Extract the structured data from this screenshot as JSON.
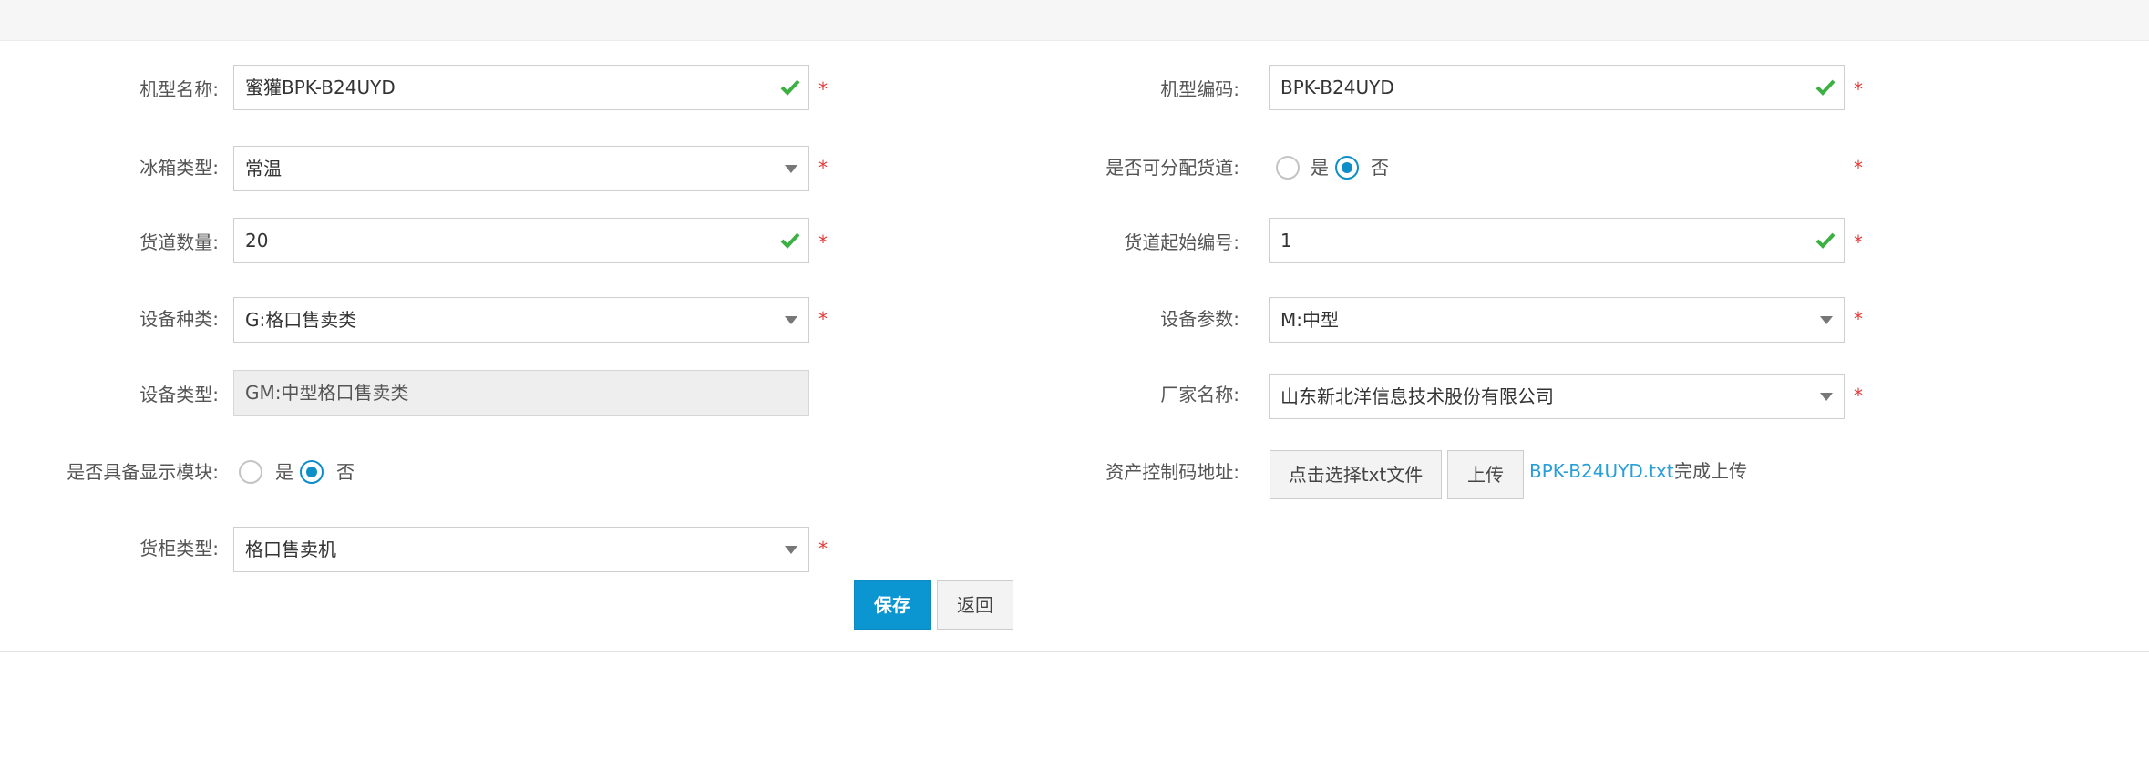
{
  "form": {
    "model_name": {
      "label": "机型名称:",
      "value": "蜜獾BPK-B24UYD"
    },
    "model_code": {
      "label": "机型编码:",
      "value": "BPK-B24UYD"
    },
    "fridge_type": {
      "label": "冰箱类型:",
      "value": "常温"
    },
    "allocatable_lanes": {
      "label": "是否可分配货道:",
      "option_yes": "是",
      "option_no": "否",
      "selected": "否"
    },
    "lane_count": {
      "label": "货道数量:",
      "value": "20"
    },
    "lane_start_no": {
      "label": "货道起始编号:",
      "value": "1"
    },
    "device_kind": {
      "label": "设备种类:",
      "value": "G:格口售卖类"
    },
    "device_params": {
      "label": "设备参数:",
      "value": "M:中型"
    },
    "device_type": {
      "label": "设备类型:",
      "value": "GM:中型格口售卖类"
    },
    "manufacturer": {
      "label": "厂家名称:",
      "value": "山东新北洋信息技术股份有限公司"
    },
    "has_display": {
      "label": "是否具备显示模块:",
      "option_yes": "是",
      "option_no": "否",
      "selected": "否"
    },
    "asset_code": {
      "label": "资产控制码地址:",
      "choose_button": "点击选择txt文件",
      "upload_button": "上传",
      "file_name": "BPK-B24UYD.txt",
      "status": "完成上传"
    },
    "cabinet_type": {
      "label": "货柜类型:",
      "value": "格口售卖机"
    },
    "required_mark": "*"
  },
  "actions": {
    "save": "保存",
    "back": "返回"
  },
  "colors": {
    "primary": "#0b96d2",
    "valid": "#3cb043",
    "required": "#e53935",
    "link": "#2a9fd6"
  }
}
